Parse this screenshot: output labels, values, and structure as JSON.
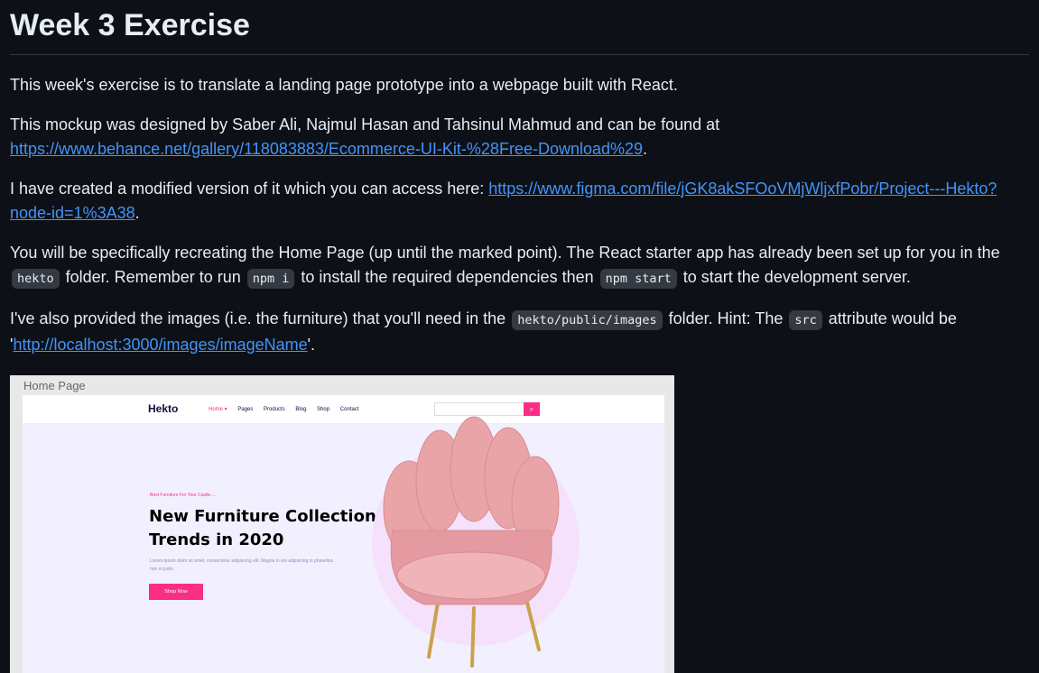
{
  "title": "Week 3 Exercise",
  "p1": "This week's exercise is to translate a landing page prototype into a webpage built with React.",
  "p2": {
    "text": "This mockup was designed by Saber Ali, Najmul Hasan and Tahsinul Mahmud and can be found at ",
    "link": "https://www.behance.net/gallery/118083883/Ecommerce-UI-Kit-%28Free-Download%29",
    "end": "."
  },
  "p3": {
    "text": "I have created a modified version of it which you can access here: ",
    "link": "https://www.figma.com/file/jGK8akSFOoVMjWljxfPobr/Project---Hekto?node-id=1%3A38",
    "end": "."
  },
  "p4": {
    "a": "You will be specifically recreating the Home Page (up until the marked point). The React starter app has already been set up for you in the ",
    "code1": "hekto",
    "b": " folder. Remember to run ",
    "code2": "npm i",
    "c": " to install the required dependencies then ",
    "code3": "npm start",
    "d": " to start the development server."
  },
  "p5": {
    "a": "I've also provided the images (i.e. the furniture) that you'll need in the ",
    "code1": "hekto/public/images",
    "b": " folder. Hint: The ",
    "code2": "src",
    "c": " attribute would be '",
    "link": "http://localhost:3000/images/imageName",
    "d": "'."
  },
  "mockup": {
    "caption": "Home Page",
    "logo": "Hekto",
    "menu": [
      "Home ▾",
      "Pages",
      "Products",
      "Blog",
      "Shop",
      "Contact"
    ],
    "search_icon": "search-icon",
    "kicker": "Best Furniture For Your Castle....",
    "headline": "New Furniture Collection Trends in 2020",
    "body": "Lorem ipsum dolor sit amet, consectetur adipiscing elit. Magna in est adipiscing in phasellus non in justo.",
    "button": "Shop Now",
    "colors": {
      "accent": "#fb2e86",
      "hero_bg": "#f2f0ff",
      "circle": "#f5e1fc",
      "chair": "#e9a4a8"
    }
  }
}
